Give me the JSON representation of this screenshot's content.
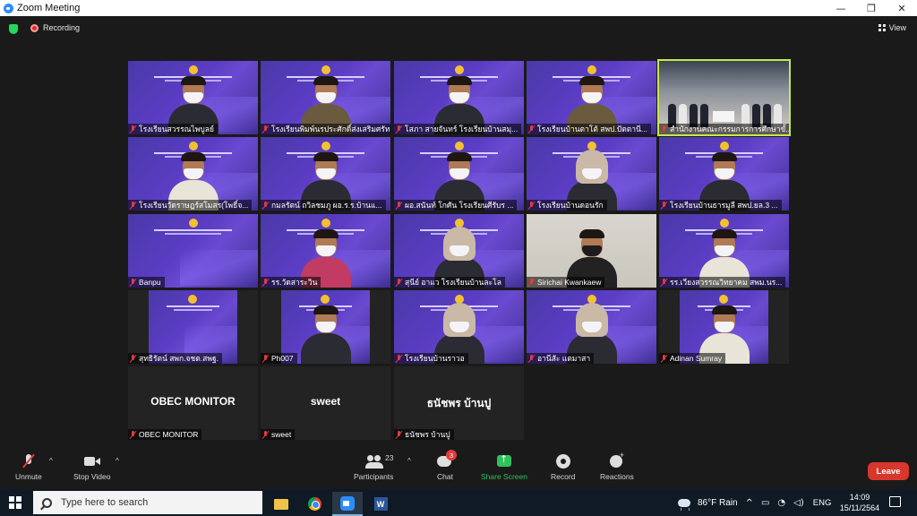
{
  "window": {
    "title": "Zoom Meeting",
    "controls": [
      "—",
      "❐",
      "✕"
    ]
  },
  "top_bar": {
    "recording_label": "Recording",
    "view_label": "View"
  },
  "tiles": [
    {
      "name": "โรงเรียนสวรรณไพบูลย์",
      "kind": "slide"
    },
    {
      "name": "โรงเรียนพิมพ์นรประศักดิ์ส่งเสริมศรัทธาสิทธิ์",
      "kind": "slide"
    },
    {
      "name": "โสภา สายจันทร์ โรงเรียนบ้านสมุ...",
      "kind": "slide"
    },
    {
      "name": "โรงเรียนบ้านตาโต้ สพป.ปัตตานี...",
      "kind": "slide"
    },
    {
      "name": "สำนักงานคณะกรรมการการศึกษาขั้...",
      "kind": "ceremony"
    },
    {
      "name": "โรงเรียนวัดราษฎร์สโมสร(โพธิ์จ...",
      "kind": "slide"
    },
    {
      "name": "กมลรัตน์ ถวิลชมภู ผอ.ร.ร.บ้านแ...",
      "kind": "slide"
    },
    {
      "name": "ผอ.สนันท์ โกศัน โรงเรียนศีรับร ...",
      "kind": "slide"
    },
    {
      "name": "โรงเรียนบ้านดอนรัก",
      "kind": "slide"
    },
    {
      "name": "โรงเรียนบ้านธารมูลี สพป.ยล.3 ...",
      "kind": "slide"
    },
    {
      "name": "Banpu",
      "kind": "slide"
    },
    {
      "name": "รร.วัดสาระวิน",
      "kind": "slide"
    },
    {
      "name": "สุนีย์ อาแว โรงเรียนบ้านละโล",
      "kind": "slide"
    },
    {
      "name": "Sirichai Kwankaew",
      "kind": "webcam"
    },
    {
      "name": "รร.เวียงสวรรณวิทยาคม สพม.นร...",
      "kind": "slide"
    },
    {
      "name": "สุทธิรัตน์ สพก.จชต.สพฐ.",
      "kind": "slide"
    },
    {
      "name": "Ph007",
      "kind": "slide"
    },
    {
      "name": "โรงเรียนบ้านราวอ",
      "kind": "slide"
    },
    {
      "name": "อานีสัะ แตมาสา",
      "kind": "slide"
    },
    {
      "name": "Adinan Sumray",
      "kind": "slide"
    },
    {
      "name": "OBEC MONITOR",
      "display": "OBEC MONITOR",
      "kind": "noimage"
    },
    {
      "name": "sweet",
      "display": "sweet",
      "kind": "noimage"
    },
    {
      "name": "ธนัชพร บ้านปู",
      "display": "ธนัชพร บ้านปู",
      "kind": "noimage"
    }
  ],
  "toolbar": {
    "unmute": "Unmute",
    "stop_video": "Stop Video",
    "participants": "Participants",
    "participants_count": "23",
    "chat": "Chat",
    "chat_badge": "3",
    "share_screen": "Share Screen",
    "record": "Record",
    "reactions": "Reactions",
    "leave": "Leave"
  },
  "taskbar": {
    "search_placeholder": "Type here to search",
    "weather": "86°F Rain",
    "language": "ENG",
    "time": "14:09",
    "date": "15/11/2564"
  },
  "colors": {
    "accent_selected": "#c5e84b",
    "leave_red": "#d8372c",
    "share_green": "#2fc25b",
    "slide_purple": "#5b3dc4"
  }
}
